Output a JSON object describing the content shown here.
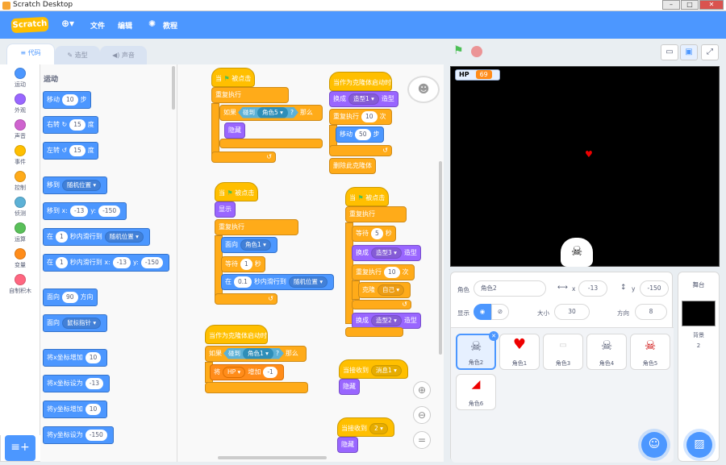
{
  "window": {
    "title": "Scratch Desktop",
    "min": "–",
    "max": "□",
    "close": "✕"
  },
  "menu": {
    "brand": "Scratch",
    "file": "文件",
    "edit": "编辑",
    "tutorials": "教程"
  },
  "tabs": {
    "code": "代码",
    "costumes": "造型",
    "sounds": "声音"
  },
  "categories": [
    {
      "label": "运动",
      "color": "#4c97ff"
    },
    {
      "label": "外观",
      "color": "#9966ff"
    },
    {
      "label": "声音",
      "color": "#cf63cf"
    },
    {
      "label": "事件",
      "color": "#ffbf00"
    },
    {
      "label": "控制",
      "color": "#ffab19"
    },
    {
      "label": "侦测",
      "color": "#5cb1d6"
    },
    {
      "label": "运算",
      "color": "#59c059"
    },
    {
      "label": "变量",
      "color": "#ff8c1a"
    },
    {
      "label": "自制积木",
      "color": "#ff6680"
    }
  ],
  "palette": {
    "section": "运动",
    "move": {
      "a": "移动",
      "n": "10",
      "b": "步"
    },
    "turn_r": {
      "a": "右转",
      "n": "15",
      "b": "度"
    },
    "turn_l": {
      "a": "左转",
      "n": "15",
      "b": "度"
    },
    "goto": {
      "a": "移到",
      "d": "随机位置"
    },
    "goto_xy": {
      "a": "移到 x:",
      "x": "-13",
      "b": "y:",
      "y": "-150"
    },
    "glide": {
      "a": "在",
      "n": "1",
      "b": "秒内滑行到",
      "d": "随机位置"
    },
    "glide_xy": {
      "a": "在",
      "n": "1",
      "b": "秒内滑行到 x:",
      "x": "-13",
      "c": "y:",
      "y": "-150"
    },
    "point": {
      "a": "面向",
      "n": "90",
      "b": "方向"
    },
    "point_to": {
      "a": "面向",
      "d": "鼠标指针"
    },
    "change_x": {
      "a": "将x坐标增加",
      "n": "10"
    },
    "set_x": {
      "a": "将x坐标设为",
      "n": "-13"
    },
    "change_y": {
      "a": "将y坐标增加",
      "n": "10"
    },
    "set_y": {
      "a": "将y坐标设为",
      "n": "-150"
    }
  },
  "scripts": {
    "s1": {
      "hat": "当",
      "hat2": "被点击",
      "forever": "重复执行",
      "if": "如果",
      "touch": "碰到",
      "sprite": "角色5",
      "q": "?",
      "then": "那么",
      "hide": "隐藏"
    },
    "s2": {
      "hat": "当作为克隆体启动时",
      "switch": "换成",
      "costume": "造型1",
      "costume_tail": "造型",
      "repeat": "重复执行",
      "n": "10",
      "times": "次",
      "move": "移动",
      "steps": "50",
      "step": "步",
      "delete": "删除此克隆体"
    },
    "s3": {
      "hat": "当",
      "hat2": "被点击",
      "show": "显示",
      "forever": "重复执行",
      "point": "面向",
      "target": "角色1",
      "wait": "等待",
      "wait_n": "1",
      "sec": "秒",
      "glide_a": "在",
      "glide_n": "0.1",
      "glide_b": "秒内滑行到",
      "glide_d": "随机位置"
    },
    "s4": {
      "hat": "当",
      "hat2": "被点击",
      "forever": "重复执行",
      "wait": "等待",
      "wait_n": "5",
      "sec": "秒",
      "switch": "换成",
      "costume3": "造型3",
      "costume_tail": "造型",
      "repeat": "重复执行",
      "n": "10",
      "times": "次",
      "clone": "克隆",
      "self": "自己",
      "costume2": "造型2"
    },
    "s5": {
      "hat": "当作为克隆体启动时",
      "if": "如果",
      "touch": "碰到",
      "sprite": "角色1",
      "q": "?",
      "then": "那么",
      "set": "将",
      "var": "HP",
      "inc": "增加",
      "val": "-1"
    },
    "s6": {
      "hat": "当接收到",
      "msg": "消息1",
      "hide": "隐藏"
    },
    "s7": {
      "hat": "当接收到",
      "msg": "2",
      "hide": "隐藏"
    }
  },
  "stage": {
    "hp_label": "HP",
    "hp_value": "69"
  },
  "sprite_info": {
    "label": "角色",
    "name": "角色2",
    "x_label": "x",
    "x": "-13",
    "y_label": "y",
    "y": "-150",
    "show_label": "显示",
    "size_label": "大小",
    "size": "30",
    "dir_label": "方向",
    "dir": "8"
  },
  "sprites": [
    {
      "name": "角色2",
      "selected": true
    },
    {
      "name": "角色1"
    },
    {
      "name": "角色3"
    },
    {
      "name": "角色4"
    },
    {
      "name": "角色5"
    },
    {
      "name": "角色6"
    }
  ],
  "stage_panel": {
    "title": "舞台",
    "backdrop_label": "背景",
    "backdrop_count": "2"
  },
  "colors": {
    "accent": "#4c97ff",
    "events": "#ffbf00",
    "control": "#ffab19",
    "looks": "#9966ff",
    "sensing": "#5cb1d6",
    "variables": "#ff8c1a"
  }
}
